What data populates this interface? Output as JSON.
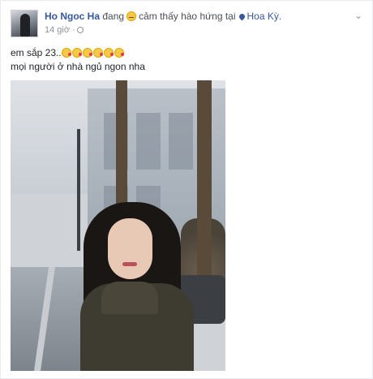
{
  "post": {
    "author": "Ho Ngoc Ha",
    "status_prefix": "đang",
    "feeling_text": "cảm thấy hào hứng tại",
    "location": "Hoa Kỳ.",
    "timestamp": "14 giờ ·",
    "more_glyph": "⌄",
    "text_line1": "em sắp 23..",
    "text_line2": "mọi người ở nhà ngủ ngon nha",
    "kiss_emoji_count": 6
  },
  "colors": {
    "name_blue": "#365899",
    "meta_gray": "#90949c",
    "text": "#1d2129"
  }
}
